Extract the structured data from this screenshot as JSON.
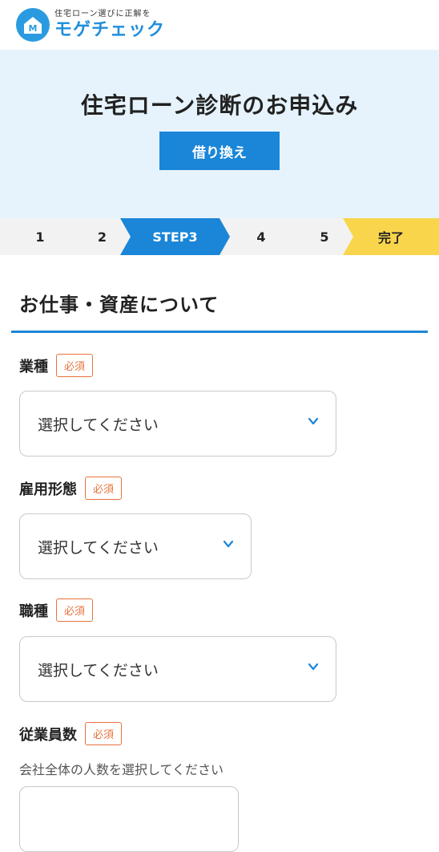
{
  "header": {
    "tagline": "住宅ローン選びに正解を",
    "brand": "モゲチェック",
    "brand_color": "#1f8fdc",
    "logo_letter": "M"
  },
  "hero": {
    "title": "住宅ローン診断のお申込み",
    "button_label": "借り換え"
  },
  "steps": [
    {
      "label": "1",
      "state": "todo"
    },
    {
      "label": "2",
      "state": "todo"
    },
    {
      "label": "STEP3",
      "state": "active"
    },
    {
      "label": "4",
      "state": "todo"
    },
    {
      "label": "5",
      "state": "todo"
    },
    {
      "label": "完了",
      "state": "final"
    }
  ],
  "section": {
    "title": "お仕事・資産について"
  },
  "required_badge": "必須",
  "fields": {
    "industry": {
      "label": "業種",
      "value": "選択してください"
    },
    "employment": {
      "label": "雇用形態",
      "value": "選択してください"
    },
    "occupation": {
      "label": "職種",
      "value": "選択してください"
    },
    "employees": {
      "label": "従業員数",
      "hint": "会社全体の人数を選択してください"
    }
  },
  "colors": {
    "accent": "#1b86d8",
    "required": "#e8733d",
    "final_step": "#f9d54b",
    "hero_bg": "#e6f3fc"
  }
}
